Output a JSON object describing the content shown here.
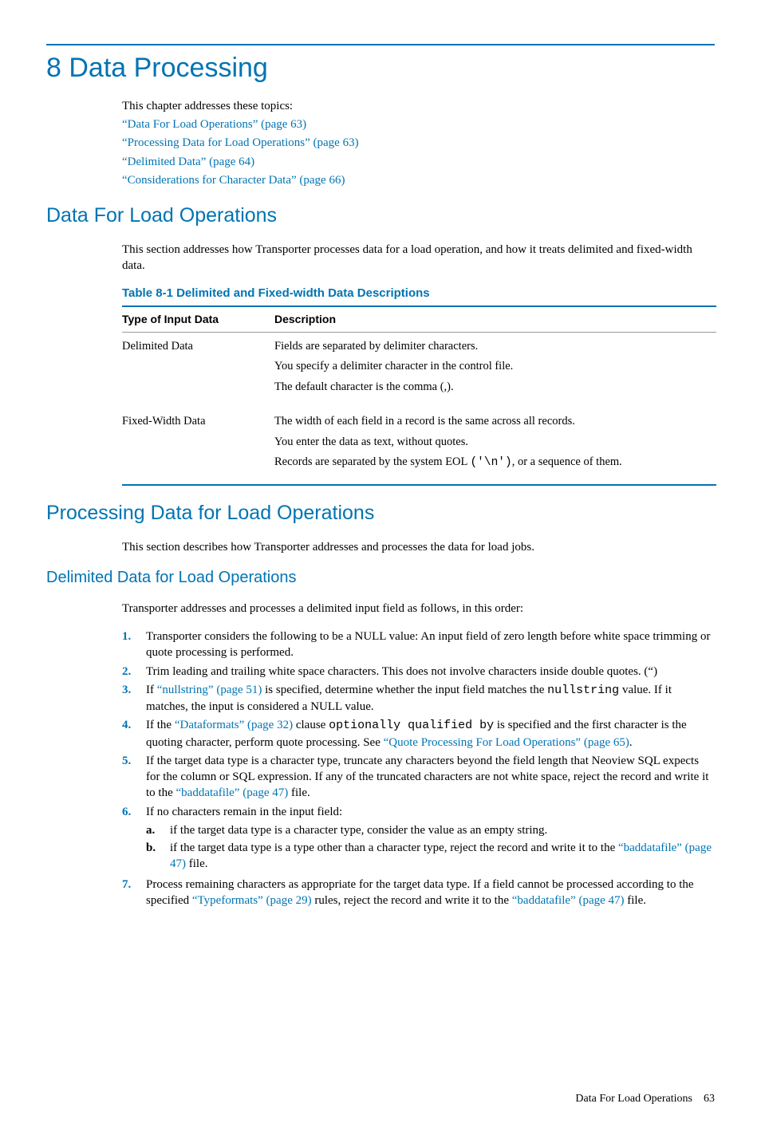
{
  "chapter": {
    "title": "8 Data Processing"
  },
  "intro": {
    "lead": "This chapter addresses these topics:",
    "links": [
      "“Data For Load Operations” (page 63)",
      "“Processing Data for Load Operations” (page 63)",
      "“Delimited Data” (page 64)",
      "“Considerations for Character Data” (page 66)"
    ]
  },
  "sec1": {
    "heading": "Data For Load Operations",
    "para": "This section addresses how Transporter processes data for a load operation, and how it treats delimited and fixed-width data.",
    "table_title": "Table  8-1  Delimited and Fixed-width Data Descriptions",
    "th_type": "Type of Input Data",
    "th_desc": "Description",
    "row1": {
      "type": "Delimited Data",
      "d1": "Fields are separated by delimiter characters.",
      "d2": "You specify a delimiter character in the control file.",
      "d3": "The default character is the comma (,)."
    },
    "row2": {
      "type": "Fixed-Width Data",
      "d1": "The width of each field in a record is the same across all records.",
      "d2": "You enter the data as text, without quotes.",
      "d3_a": "Records are separated by the system EOL ",
      "d3_b": "('\\n')",
      "d3_c": ", or a sequence of them."
    }
  },
  "sec2": {
    "heading": "Processing Data for Load Operations",
    "para": "This section describes how Transporter addresses and processes the data for load jobs.",
    "sub_heading": "Delimited Data for Load Operations",
    "sub_para": "Transporter addresses and processes a delimited input field as follows, in this order:",
    "steps": {
      "s1": "Transporter considers the following to be a NULL value: An input field of zero length before white space trimming or quote processing is performed.",
      "s2": "Trim leading and trailing white space characters. This does not involve characters inside double quotes. (“)",
      "s3_a": "If ",
      "s3_link1": "“nullstring” (page 51)",
      "s3_b": " is specified, determine whether the input field matches the ",
      "s3_code": "nullstring",
      "s3_c": " value. If it matches, the input is considered a NULL value.",
      "s4_a": "If the ",
      "s4_link1": "“Dataformats” (page 32)",
      "s4_b": " clause ",
      "s4_code": "optionally qualified by",
      "s4_c": " is specified and the first character is the quoting character, perform quote processing. See ",
      "s4_link2": "“Quote Processing For Load Operations” (page 65)",
      "s4_d": ".",
      "s5_a": "If the target data type is a character type, truncate any characters beyond the field length that Neoview SQL expects for the column or SQL expression. If any of the truncated characters are not white space, reject the record and write it to the ",
      "s5_link": "“baddatafile” (page 47)",
      "s5_b": " file.",
      "s6": "If no characters remain in the input field:",
      "s6a": "if the target data type is a character type, consider the value as an empty string.",
      "s6b_a": "if the target data type is a type other than a character type, reject the record and write it to the ",
      "s6b_link": "“baddatafile” (page 47)",
      "s6b_b": " file.",
      "s7_a": "Process remaining characters as appropriate for the target data type. If a field cannot be processed according to the specified ",
      "s7_link1": "“Typeformats” (page 29)",
      "s7_b": " rules, reject the record and write it to the ",
      "s7_link2": "“baddatafile” (page 47)",
      "s7_c": " file."
    }
  },
  "footer": {
    "label": "Data For Load Operations",
    "page": "63"
  }
}
